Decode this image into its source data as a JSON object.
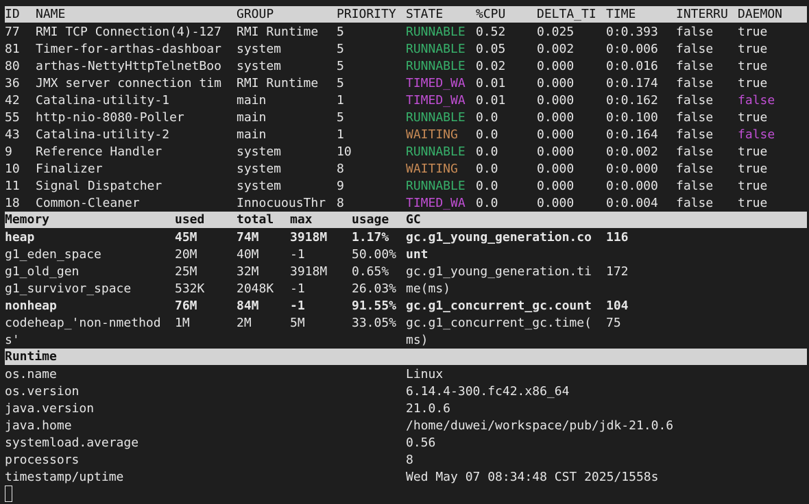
{
  "threads": {
    "headers": [
      "ID",
      "NAME",
      "GROUP",
      "PRIORITY",
      "STATE",
      "%CPU",
      "DELTA_TI",
      "TIME",
      "INTERRU",
      "DAEMON"
    ],
    "rows": [
      {
        "id": "77",
        "name": "RMI TCP Connection(4)-127",
        "group": "RMI Runtime",
        "priority": "5",
        "state": "RUNNABLE",
        "cpu": "0.52",
        "delta": "0.025",
        "time": "0:0.393",
        "interrupted": "false",
        "daemon": "true"
      },
      {
        "id": "81",
        "name": "Timer-for-arthas-dashboar",
        "group": "system",
        "priority": "5",
        "state": "RUNNABLE",
        "cpu": "0.05",
        "delta": "0.002",
        "time": "0:0.006",
        "interrupted": "false",
        "daemon": "true"
      },
      {
        "id": "80",
        "name": "arthas-NettyHttpTelnetBoo",
        "group": "system",
        "priority": "5",
        "state": "RUNNABLE",
        "cpu": "0.02",
        "delta": "0.000",
        "time": "0:0.016",
        "interrupted": "false",
        "daemon": "true"
      },
      {
        "id": "36",
        "name": "JMX server connection tim",
        "group": "RMI Runtime",
        "priority": "5",
        "state": "TIMED_WA",
        "cpu": "0.01",
        "delta": "0.000",
        "time": "0:0.174",
        "interrupted": "false",
        "daemon": "true"
      },
      {
        "id": "42",
        "name": "Catalina-utility-1",
        "group": "main",
        "priority": "1",
        "state": "TIMED_WA",
        "cpu": "0.01",
        "delta": "0.000",
        "time": "0:0.162",
        "interrupted": "false",
        "daemon": "false"
      },
      {
        "id": "55",
        "name": "http-nio-8080-Poller",
        "group": "main",
        "priority": "5",
        "state": "RUNNABLE",
        "cpu": "0.0",
        "delta": "0.000",
        "time": "0:0.100",
        "interrupted": "false",
        "daemon": "true"
      },
      {
        "id": "43",
        "name": "Catalina-utility-2",
        "group": "main",
        "priority": "1",
        "state": "WAITING",
        "cpu": "0.0",
        "delta": "0.000",
        "time": "0:0.164",
        "interrupted": "false",
        "daemon": "false"
      },
      {
        "id": "9",
        "name": "Reference Handler",
        "group": "system",
        "priority": "10",
        "state": "RUNNABLE",
        "cpu": "0.0",
        "delta": "0.000",
        "time": "0:0.002",
        "interrupted": "false",
        "daemon": "true"
      },
      {
        "id": "10",
        "name": "Finalizer",
        "group": "system",
        "priority": "8",
        "state": "WAITING",
        "cpu": "0.0",
        "delta": "0.000",
        "time": "0:0.000",
        "interrupted": "false",
        "daemon": "true"
      },
      {
        "id": "11",
        "name": "Signal Dispatcher",
        "group": "system",
        "priority": "9",
        "state": "RUNNABLE",
        "cpu": "0.0",
        "delta": "0.000",
        "time": "0:0.000",
        "interrupted": "false",
        "daemon": "true"
      },
      {
        "id": "18",
        "name": "Common-Cleaner",
        "group": "InnocuousThr",
        "priority": "8",
        "state": "TIMED_WA",
        "cpu": "0.0",
        "delta": "0.000",
        "time": "0:0.004",
        "interrupted": "false",
        "daemon": "true"
      }
    ]
  },
  "memory": {
    "headers": [
      "Memory",
      "used",
      "total",
      "max",
      "usage",
      "GC"
    ],
    "rows": [
      {
        "name": "heap",
        "used": "45M",
        "total": "74M",
        "max": "3918M",
        "usage": "1.17%",
        "gc": "gc.g1_young_generation.co",
        "gcval": "116",
        "bold": true
      },
      {
        "name": "g1_eden_space",
        "used": "20M",
        "total": "40M",
        "max": "-1",
        "usage": "50.00%",
        "gc": "unt",
        "gcval": "",
        "bold": false,
        "gcbold": true
      },
      {
        "name": "g1_old_gen",
        "used": "25M",
        "total": "32M",
        "max": "3918M",
        "usage": "0.65%",
        "gc": "gc.g1_young_generation.ti",
        "gcval": "172",
        "bold": false
      },
      {
        "name": "g1_survivor_space",
        "used": "532K",
        "total": "2048K",
        "max": "-1",
        "usage": "26.03%",
        "gc": "me(ms)",
        "gcval": "",
        "bold": false
      },
      {
        "name": "nonheap",
        "used": "76M",
        "total": "84M",
        "max": "-1",
        "usage": "91.55%",
        "gc": "gc.g1_concurrent_gc.count",
        "gcval": "104",
        "bold": true
      },
      {
        "name": "codeheap_'non-nmethod",
        "used": "1M",
        "total": "2M",
        "max": "5M",
        "usage": "33.05%",
        "gc": "gc.g1_concurrent_gc.time(",
        "gcval": "75",
        "bold": false
      },
      {
        "name": "s'",
        "used": "",
        "total": "",
        "max": "",
        "usage": "",
        "gc": "ms)",
        "gcval": "",
        "bold": false
      }
    ]
  },
  "runtime": {
    "header": "Runtime",
    "rows": [
      {
        "key": "os.name",
        "value": "Linux"
      },
      {
        "key": "os.version",
        "value": "6.14.4-300.fc42.x86_64"
      },
      {
        "key": "java.version",
        "value": "21.0.6"
      },
      {
        "key": "java.home",
        "value": "/home/duwei/workspace/pub/jdk-21.0.6"
      },
      {
        "key": "systemload.average",
        "value": "0.56"
      },
      {
        "key": "processors",
        "value": "8"
      },
      {
        "key": "timestamp/uptime",
        "value": "Wed May 07 08:34:48 CST 2025/1558s"
      }
    ]
  }
}
